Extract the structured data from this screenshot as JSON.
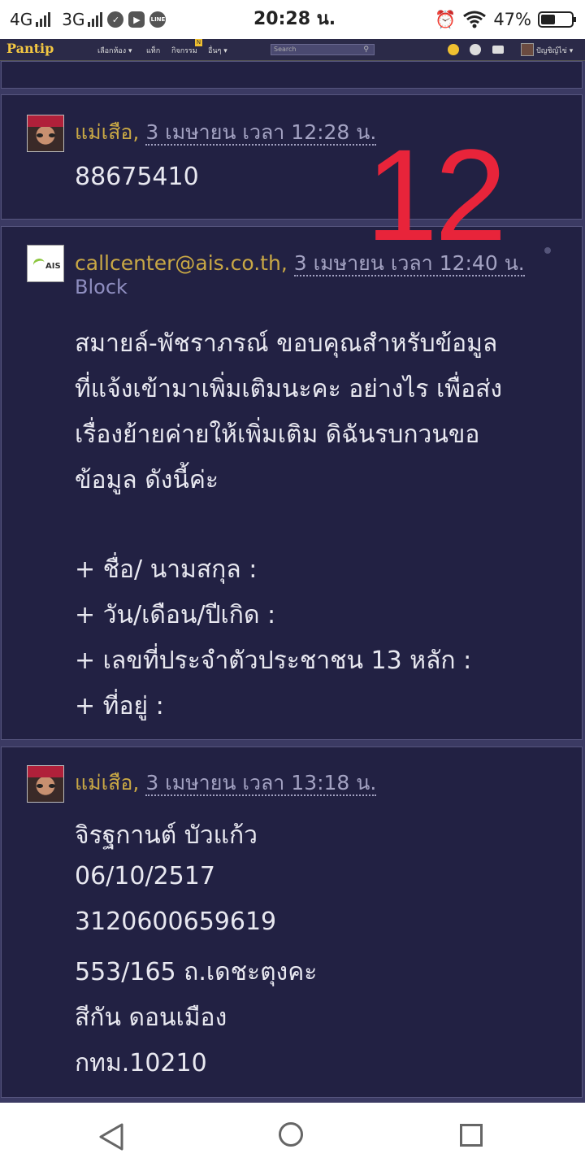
{
  "status_bar": {
    "network_1": "4G",
    "network_2": "3G",
    "time": "20:28 น.",
    "battery": "47%",
    "battery_level": 0.47
  },
  "nav": {
    "logo": "Pantip",
    "menu_rooms": "เลือกห้อง ▾",
    "menu_tags": "แท็ก",
    "menu_activity": "กิจกรรม",
    "activity_badge": "N",
    "menu_more": "อื่นๆ ▾",
    "search_placeholder": "Search",
    "username": "ปัญชิญ์ไข่ ▾"
  },
  "overlay_number": "12",
  "comments": [
    {
      "author": "แม่เสือ",
      "date": "3 เมษายน เวลา 12:28 น.",
      "lines": [
        "88675410"
      ]
    },
    {
      "author": "callcenter@ais.co.th",
      "date": "3 เมษายน เวลา 12:40 น.",
      "block_label": "Block",
      "avatar_text": "AIS",
      "lines": [
        "สมายล์-พัชราภรณ์ ขอบคุณสำหรับข้อมูล",
        "ที่แจ้งเข้ามาเพิ่มเติมนะคะ อย่างไร  เพื่อส่ง",
        "เรื่องย้ายค่ายให้เพิ่มเติม ดิฉันรบกวนขอ",
        "ข้อมูล ดังนี้ค่ะ",
        "+ ชื่อ/ นามสกุล :",
        "+ วัน/เดือน/ปีเกิด :",
        "+ เลขที่ประจำตัวประชาชน 13 หลัก :",
        "+ ที่อยู่ :"
      ]
    },
    {
      "author": "แม่เสือ",
      "date": "3 เมษายน เวลา 13:18 น.",
      "lines": [
        "จิรฐกานต์  บัวแก้ว",
        "06/10/2517",
        "3120600659619",
        "553/165  ถ.เดชะตุงคะ",
        "สีกัน  ดอนเมือง",
        "กทม.10210"
      ]
    }
  ]
}
